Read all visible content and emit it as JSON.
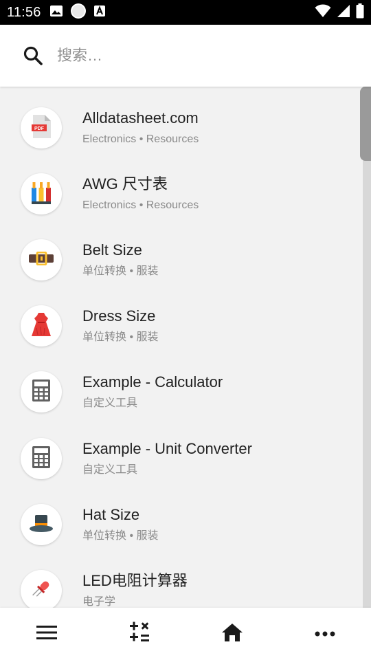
{
  "status_bar": {
    "time": "11:56",
    "left_icons": [
      "image-icon",
      "circle-icon",
      "font-icon"
    ],
    "right_icons": [
      "wifi-icon",
      "signal-icon",
      "battery-icon"
    ]
  },
  "search": {
    "placeholder": "搜索…",
    "value": ""
  },
  "items": [
    {
      "title": "Alldatasheet.com",
      "subtitle": "Electronics • Resources",
      "icon": "pdf-file-icon"
    },
    {
      "title": "AWG 尺寸表",
      "subtitle": "Electronics • Resources",
      "icon": "wires-icon"
    },
    {
      "title": "Belt Size",
      "subtitle": "单位转换 • 服装",
      "icon": "belt-icon"
    },
    {
      "title": "Dress Size",
      "subtitle": "单位转换 • 服装",
      "icon": "dress-icon"
    },
    {
      "title": "Example - Calculator",
      "subtitle": "自定义工具",
      "icon": "calculator-icon"
    },
    {
      "title": "Example - Unit Converter",
      "subtitle": "自定义工具",
      "icon": "calculator-icon"
    },
    {
      "title": "Hat Size",
      "subtitle": "单位转换 • 服装",
      "icon": "hat-icon"
    },
    {
      "title": "LED电阻计算器",
      "subtitle": "电子学",
      "icon": "led-icon"
    }
  ],
  "bottom_nav": {
    "items": [
      "menu-icon",
      "calculator-ops-icon",
      "home-icon",
      "more-icon"
    ]
  },
  "colors": {
    "status_bar": "#000000",
    "background": "#f2f2f2",
    "title_text": "#212121",
    "subtitle_text": "#8a8a8a"
  }
}
